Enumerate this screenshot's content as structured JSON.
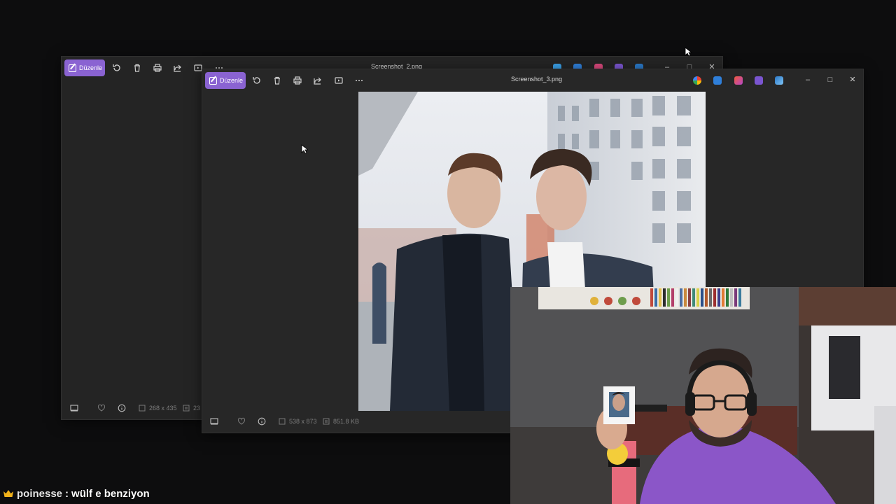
{
  "viewer_back": {
    "edit_label": "Düzenle",
    "title": "Screenshot_2.png",
    "dimensions": "268 x 435",
    "size_partial": "23"
  },
  "viewer_front": {
    "edit_label": "Düzenle",
    "title": "Screenshot_3.png",
    "dimensions": "538 x 873",
    "size": "851.8 KB"
  },
  "chat": {
    "username": "poinesse",
    "separator": ":",
    "message": "wülf e benziyon"
  },
  "colors": {
    "accent": "#8a63d2",
    "window_bg": "#272727",
    "desktop_bg": "#0d0d0e"
  }
}
